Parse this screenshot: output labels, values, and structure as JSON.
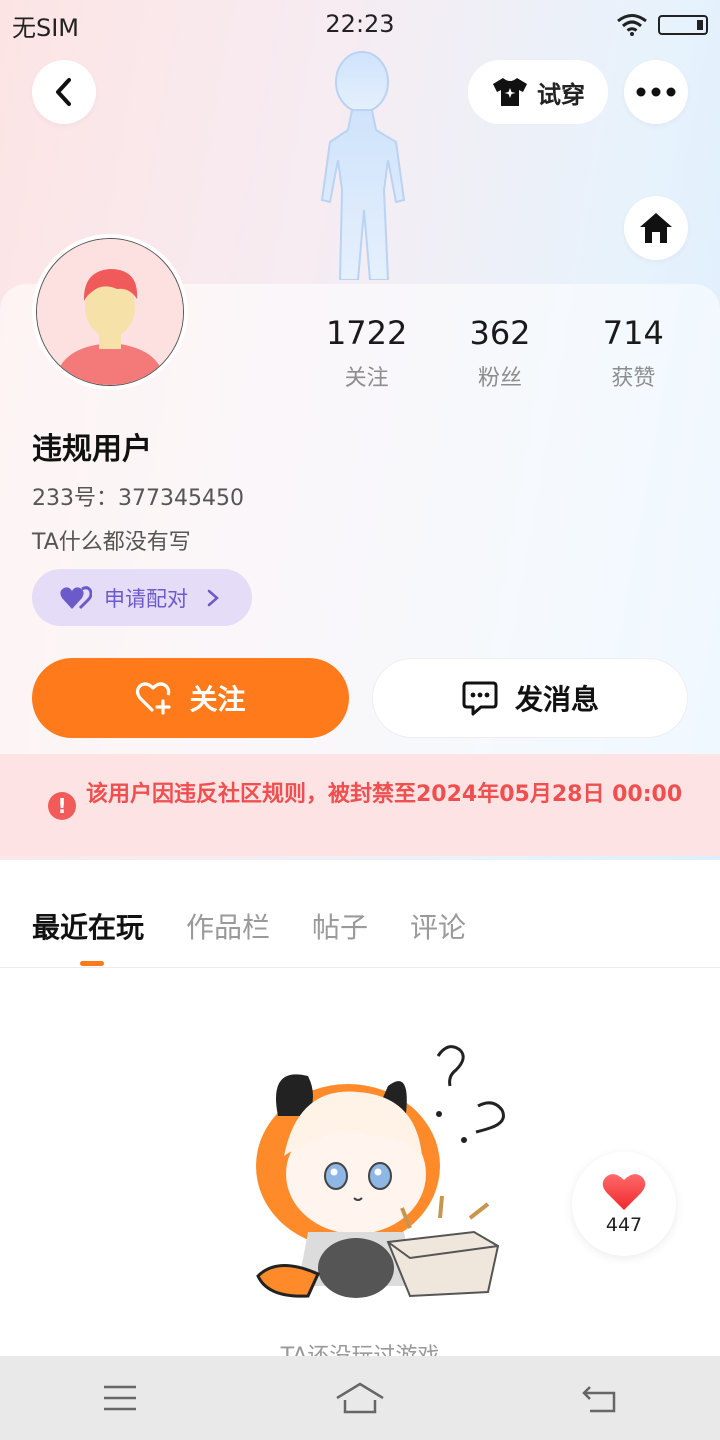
{
  "status_bar": {
    "carrier": "无SIM",
    "time": "22:23",
    "wifi_icon": "wifi-icon",
    "battery_icon": "battery-icon"
  },
  "header": {
    "back_icon": "chevron-left-icon",
    "try_on_label": "试穿",
    "more_icon": "more-dots-icon",
    "home_icon": "home-icon"
  },
  "profile": {
    "username": "违规用户",
    "uid_label": "233号：",
    "uid": "377345450",
    "bio": "TA什么都没有写",
    "pair_label": "申请配对"
  },
  "stats": [
    {
      "value": "1722",
      "label": "关注"
    },
    {
      "value": "362",
      "label": "粉丝"
    },
    {
      "value": "714",
      "label": "获赞"
    }
  ],
  "actions": {
    "follow_label": "关注",
    "message_label": "发消息"
  },
  "ban_notice": {
    "text": "该用户因违反社区规则，被封禁至2024年05月28日 00:00"
  },
  "tabs": [
    {
      "label": "最近在玩",
      "active": true
    },
    {
      "label": "作品栏",
      "active": false
    },
    {
      "label": "帖子",
      "active": false
    },
    {
      "label": "评论",
      "active": false
    }
  ],
  "empty_state": {
    "text": "TA还没玩过游戏"
  },
  "like_fab": {
    "count": "447"
  },
  "colors": {
    "accent": "#ff7a1a",
    "ban_red": "#ef4f4f",
    "pair_purple": "#6b5bc9"
  }
}
